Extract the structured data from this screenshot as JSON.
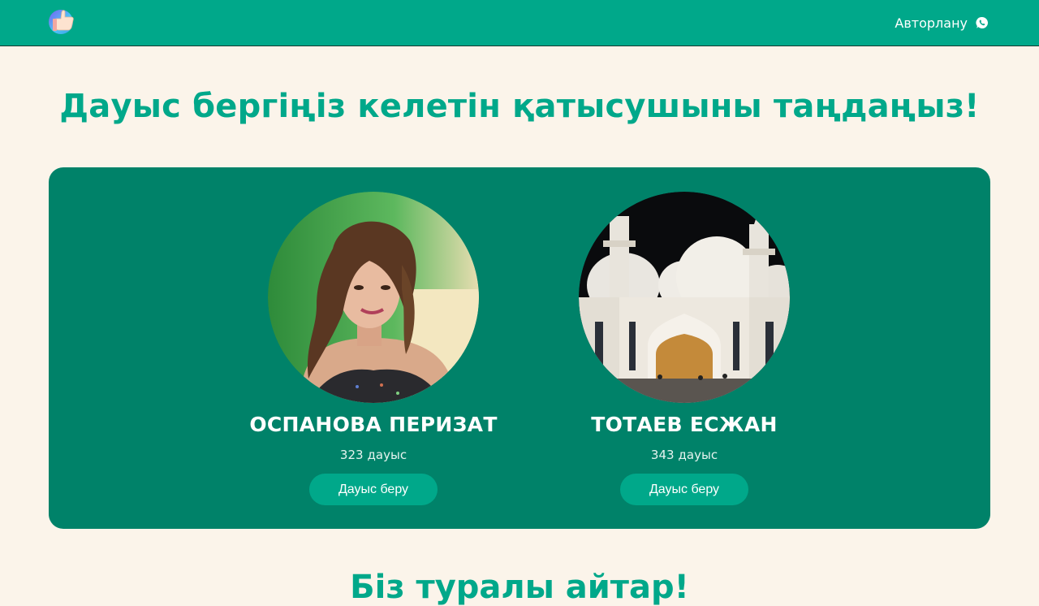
{
  "header": {
    "logo_icon": "thumbs-up-logo-icon",
    "login_label": "Авторлану",
    "login_icon": "whatsapp-icon"
  },
  "main": {
    "heading": "Дауыс бергіңіз келетін қатысушыны таңдаңыз!",
    "candidates": [
      {
        "name": "ОСПАНОВА ПЕРИЗАТ",
        "votes": "323",
        "votes_unit": "дауыс",
        "button_label": "Дауыс беру",
        "photo": "portrait-photo"
      },
      {
        "name": "ТОТАЕВ ЕСЖАН",
        "votes": "343",
        "votes_unit": "дауыс",
        "button_label": "Дауыс беру",
        "photo": "mosque-night-photo"
      }
    ],
    "next_heading": "Біз туралы айтар!"
  },
  "colors": {
    "header_bg": "#00A88A",
    "panel_bg": "#008269",
    "page_bg": "#FBF4EA",
    "accent": "#00A88A"
  }
}
